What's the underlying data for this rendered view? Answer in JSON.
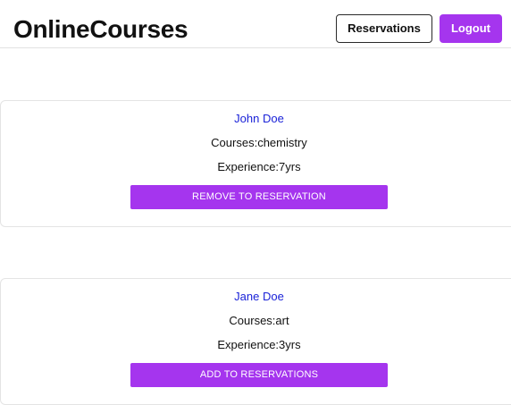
{
  "header": {
    "brand": "OnlineCourses",
    "reservations_label": "Reservations",
    "logout_label": "Logout"
  },
  "colors": {
    "accent": "#a535ee",
    "link": "#1a22d8"
  },
  "teachers": [
    {
      "name": "John Doe",
      "courses": "Courses:chemistry",
      "experience": "Experience:7yrs",
      "action_label": "REMOVE TO RESERVATION"
    },
    {
      "name": "Jane Doe",
      "courses": "Courses:art",
      "experience": "Experience:3yrs",
      "action_label": "ADD TO RESERVATIONS"
    }
  ]
}
